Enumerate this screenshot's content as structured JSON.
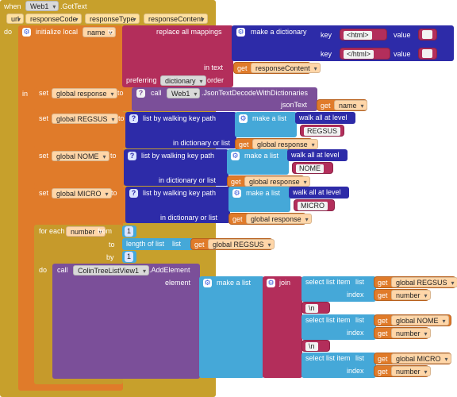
{
  "event": {
    "when_kw": "when",
    "component": "Web1",
    "event_name": ".GotText",
    "params": [
      "url",
      "responseCode",
      "responseType",
      "responseContent"
    ],
    "do_kw": "do"
  },
  "init_local": {
    "label": "initialize local",
    "var_name": "name",
    "to_kw": "to",
    "in_kw": "in"
  },
  "replace": {
    "label": "replace all mappings",
    "in_text_label": "in text",
    "preferring_label": "preferring",
    "preferring_value": "dictionary",
    "order_label": "order"
  },
  "make_dict": {
    "label": "make a dictionary",
    "key_label": "key",
    "value_label": "value",
    "pairs": [
      {
        "key": "<html>",
        "value": ""
      },
      {
        "key": "</html>",
        "value": ""
      }
    ]
  },
  "get_kw": "get",
  "set_kw": "set",
  "to_kw": "to",
  "response_content_var": "responseContent",
  "name_var": "name",
  "set_response": {
    "var": "global response",
    "call_kw": "call",
    "component": "Web1",
    "method": ".JsonTextDecodeWithDictionaries",
    "arg_label": "jsonText"
  },
  "walks": [
    {
      "var": "global REGSUS",
      "label": "list by walking key path",
      "make_list": "make a list",
      "walk_all": "walk all at level",
      "text": "REGSUS",
      "in_label": "in dictionary or list",
      "source": "global response"
    },
    {
      "var": "global NOME",
      "label": "list by walking key path",
      "make_list": "make a list",
      "walk_all": "walk all at level",
      "text": "NOME",
      "in_label": "in dictionary or list",
      "source": "global response"
    },
    {
      "var": "global MICRO",
      "label": "list by walking key path",
      "make_list": "make a list",
      "walk_all": "walk all at level",
      "text": "MICRO",
      "in_label": "in dictionary or list",
      "source": "global response"
    }
  ],
  "for_each": {
    "label": "for each",
    "var": "number",
    "from_label": "from",
    "from_value": "1",
    "to_label": "to",
    "length_label": "length of list",
    "list_label": "list",
    "list_var": "global REGSUS",
    "by_label": "by",
    "by_value": "1",
    "do_kw": "do"
  },
  "add_element": {
    "call_kw": "call",
    "component": "ColinTreeListView1",
    "method": ".AddElement",
    "element_label": "element",
    "make_list": "make a list",
    "join_label": "join",
    "select_label": "select list item",
    "list_label": "list",
    "index_label": "index",
    "index_var": "number",
    "separator": "\\n",
    "items": [
      "global REGSUS",
      "global NOME",
      "global MICRO"
    ]
  },
  "colors": {
    "event": "#c7a02c",
    "variables": "#e07b2a",
    "dictionary": "#2d2ba8",
    "text": "#b32e5b",
    "lists": "#45a8d8",
    "control": "#c69a2b",
    "component": "#7b4f99"
  }
}
